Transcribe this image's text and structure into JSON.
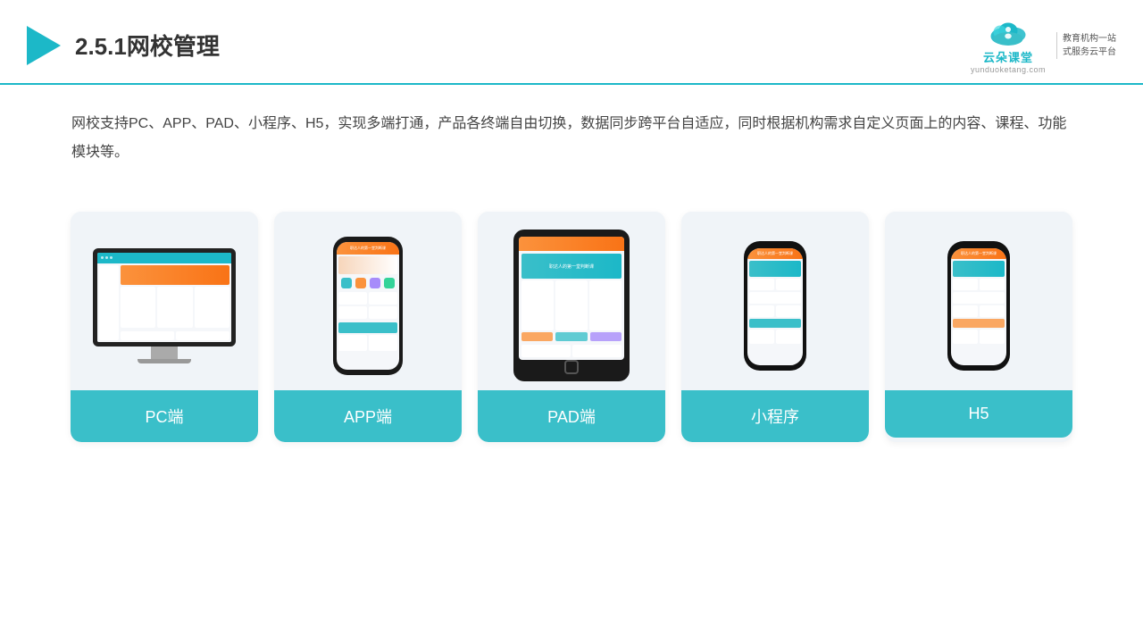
{
  "header": {
    "title": "2.5.1网校管理",
    "brand": {
      "name": "云朵课堂",
      "url": "yunduoketang.com",
      "slogan_line1": "教育机构一站",
      "slogan_line2": "式服务云平台"
    }
  },
  "description": {
    "text": "网校支持PC、APP、PAD、小程序、H5，实现多端打通，产品各终端自由切换，数据同步跨平台自适应，同时根据机构需求自定义页面上的内容、课程、功能模块等。"
  },
  "cards": [
    {
      "id": "pc",
      "label": "PC端"
    },
    {
      "id": "app",
      "label": "APP端"
    },
    {
      "id": "pad",
      "label": "PAD端"
    },
    {
      "id": "miniprogram",
      "label": "小程序"
    },
    {
      "id": "h5",
      "label": "H5"
    }
  ],
  "colors": {
    "accent": "#3abfc9",
    "accent_dark": "#1cb8c8",
    "bg_card": "#eef2f7",
    "orange": "#fb923c"
  }
}
